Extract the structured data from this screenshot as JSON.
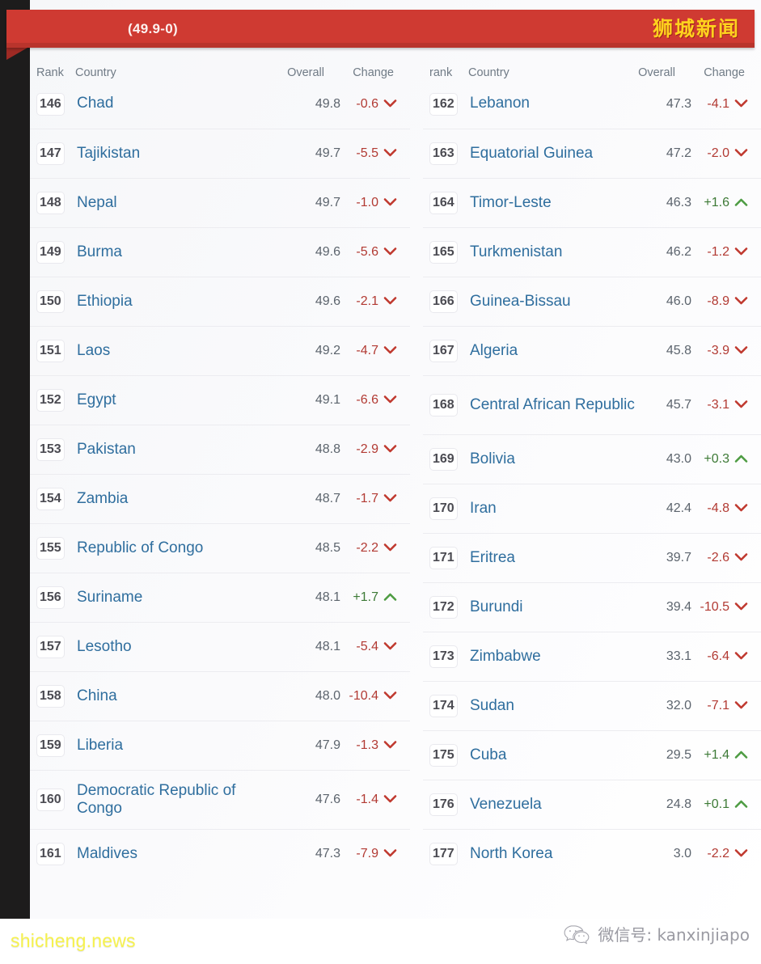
{
  "banner": {
    "title": "(49.9-0)",
    "brand": "狮城新闻",
    "color": "#cf3a32",
    "brand_color": "#ffd21e"
  },
  "table_left": {
    "headers": {
      "rank": "Rank",
      "country": "Country",
      "overall": "Overall",
      "change": "Change"
    },
    "rows": [
      {
        "rank": "146",
        "country": "Chad",
        "overall": "49.8",
        "change": "-0.6",
        "dir": "down"
      },
      {
        "rank": "147",
        "country": "Tajikistan",
        "overall": "49.7",
        "change": "-5.5",
        "dir": "down"
      },
      {
        "rank": "148",
        "country": "Nepal",
        "overall": "49.7",
        "change": "-1.0",
        "dir": "down"
      },
      {
        "rank": "149",
        "country": "Burma",
        "overall": "49.6",
        "change": "-5.6",
        "dir": "down"
      },
      {
        "rank": "150",
        "country": "Ethiopia",
        "overall": "49.6",
        "change": "-2.1",
        "dir": "down"
      },
      {
        "rank": "151",
        "country": "Laos",
        "overall": "49.2",
        "change": "-4.7",
        "dir": "down"
      },
      {
        "rank": "152",
        "country": "Egypt",
        "overall": "49.1",
        "change": "-6.6",
        "dir": "down"
      },
      {
        "rank": "153",
        "country": "Pakistan",
        "overall": "48.8",
        "change": "-2.9",
        "dir": "down"
      },
      {
        "rank": "154",
        "country": "Zambia",
        "overall": "48.7",
        "change": "-1.7",
        "dir": "down"
      },
      {
        "rank": "155",
        "country": "Republic of Congo",
        "overall": "48.5",
        "change": "-2.2",
        "dir": "down"
      },
      {
        "rank": "156",
        "country": "Suriname",
        "overall": "48.1",
        "change": "+1.7",
        "dir": "up"
      },
      {
        "rank": "157",
        "country": "Lesotho",
        "overall": "48.1",
        "change": "-5.4",
        "dir": "down"
      },
      {
        "rank": "158",
        "country": "China",
        "overall": "48.0",
        "change": "-10.4",
        "dir": "down"
      },
      {
        "rank": "159",
        "country": "Liberia",
        "overall": "47.9",
        "change": "-1.3",
        "dir": "down"
      },
      {
        "rank": "160",
        "country": "Democratic Republic of Congo",
        "overall": "47.6",
        "change": "-1.4",
        "dir": "down",
        "tall": true
      },
      {
        "rank": "161",
        "country": "Maldives",
        "overall": "47.3",
        "change": "-7.9",
        "dir": "down"
      }
    ]
  },
  "table_right": {
    "headers": {
      "rank": "rank",
      "country": "Country",
      "overall": "Overall",
      "change": "Change"
    },
    "rows": [
      {
        "rank": "162",
        "country": "Lebanon",
        "overall": "47.3",
        "change": "-4.1",
        "dir": "down"
      },
      {
        "rank": "163",
        "country": "Equatorial Guinea",
        "overall": "47.2",
        "change": "-2.0",
        "dir": "down"
      },
      {
        "rank": "164",
        "country": "Timor-Leste",
        "overall": "46.3",
        "change": "+1.6",
        "dir": "up"
      },
      {
        "rank": "165",
        "country": "Turkmenistan",
        "overall": "46.2",
        "change": "-1.2",
        "dir": "down"
      },
      {
        "rank": "166",
        "country": "Guinea-Bissau",
        "overall": "46.0",
        "change": "-8.9",
        "dir": "down"
      },
      {
        "rank": "167",
        "country": "Algeria",
        "overall": "45.8",
        "change": "-3.9",
        "dir": "down"
      },
      {
        "rank": "168",
        "country": "Central African Republic",
        "overall": "45.7",
        "change": "-3.1",
        "dir": "down",
        "tall": true
      },
      {
        "rank": "169",
        "country": "Bolivia",
        "overall": "43.0",
        "change": "+0.3",
        "dir": "up"
      },
      {
        "rank": "170",
        "country": "Iran",
        "overall": "42.4",
        "change": "-4.8",
        "dir": "down"
      },
      {
        "rank": "171",
        "country": "Eritrea",
        "overall": "39.7",
        "change": "-2.6",
        "dir": "down"
      },
      {
        "rank": "172",
        "country": "Burundi",
        "overall": "39.4",
        "change": "-10.5",
        "dir": "down"
      },
      {
        "rank": "173",
        "country": "Zimbabwe",
        "overall": "33.1",
        "change": "-6.4",
        "dir": "down"
      },
      {
        "rank": "174",
        "country": "Sudan",
        "overall": "32.0",
        "change": "-7.1",
        "dir": "down"
      },
      {
        "rank": "175",
        "country": "Cuba",
        "overall": "29.5",
        "change": "+1.4",
        "dir": "up"
      },
      {
        "rank": "176",
        "country": "Venezuela",
        "overall": "24.8",
        "change": "+0.1",
        "dir": "up"
      },
      {
        "rank": "177",
        "country": "North Korea",
        "overall": "3.0",
        "change": "-2.2",
        "dir": "down"
      }
    ]
  },
  "footer": {
    "watermark": "shicheng.news",
    "wechat_label": "微信号: kanxinjiapo",
    "wechat_icon": "wechat-icon",
    "watermark_color": "#f6f24e"
  }
}
